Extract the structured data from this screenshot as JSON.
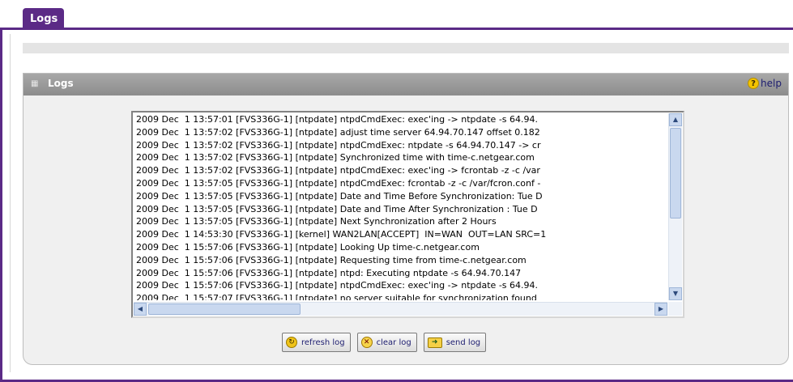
{
  "tab": {
    "label": "Logs"
  },
  "panel": {
    "title": "Logs",
    "help_label": "help"
  },
  "log": {
    "lines": [
      "2009 Dec  1 13:57:01 [FVS336G-1] [ntpdate] ntpdCmdExec: exec'ing -> ntpdate -s 64.94.",
      "2009 Dec  1 13:57:02 [FVS336G-1] [ntpdate] adjust time server 64.94.70.147 offset 0.182",
      "2009 Dec  1 13:57:02 [FVS336G-1] [ntpdate] ntpdCmdExec: ntpdate -s 64.94.70.147 -> cr",
      "2009 Dec  1 13:57:02 [FVS336G-1] [ntpdate] Synchronized time with time-c.netgear.com",
      "2009 Dec  1 13:57:02 [FVS336G-1] [ntpdate] ntpdCmdExec: exec'ing -> fcrontab -z -c /var",
      "2009 Dec  1 13:57:05 [FVS336G-1] [ntpdate] ntpdCmdExec: fcrontab -z -c /var/fcron.conf -",
      "2009 Dec  1 13:57:05 [FVS336G-1] [ntpdate] Date and Time Before Synchronization: Tue D",
      "2009 Dec  1 13:57:05 [FVS336G-1] [ntpdate] Date and Time After Synchronization : Tue D",
      "2009 Dec  1 13:57:05 [FVS336G-1] [ntpdate] Next Synchronization after 2 Hours",
      "2009 Dec  1 14:53:30 [FVS336G-1] [kernel] WAN2LAN[ACCEPT]  IN=WAN  OUT=LAN SRC=1",
      "2009 Dec  1 15:57:06 [FVS336G-1] [ntpdate] Looking Up time-c.netgear.com",
      "2009 Dec  1 15:57:06 [FVS336G-1] [ntpdate] Requesting time from time-c.netgear.com",
      "2009 Dec  1 15:57:06 [FVS336G-1] [ntpdate] ntpd: Executing ntpdate -s 64.94.70.147",
      "2009 Dec  1 15:57:06 [FVS336G-1] [ntpdate] ntpdCmdExec: exec'ing -> ntpdate -s 64.94.",
      "2009 Dec  1 15:57:07 [FVS336G-1] [ntpdate] no server suitable for synchronization found"
    ]
  },
  "buttons": {
    "refresh": "refresh log",
    "clear": "clear log",
    "send": "send log"
  },
  "icons": {
    "help": "help-icon",
    "refresh": "refresh-icon",
    "clear": "clear-icon",
    "send": "send-icon"
  },
  "colors": {
    "accent": "#5b2a86",
    "panel_header": "#9a9a9a",
    "scrollbar": "#c9d8ef"
  }
}
